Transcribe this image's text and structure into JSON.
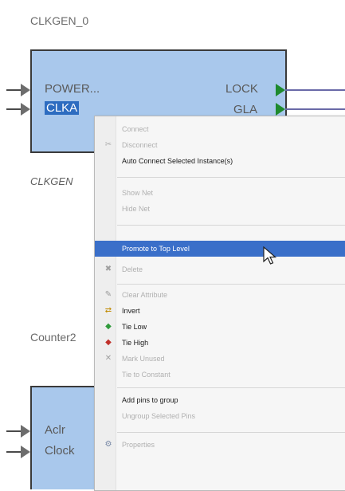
{
  "components": {
    "clkgen": {
      "title": "CLKGEN_0",
      "inputs": [
        "POWER...",
        "CLKA"
      ],
      "outputs": [
        "LOCK",
        "GLA"
      ],
      "instance_label": "CLKGEN"
    },
    "counter": {
      "title": "Counter2",
      "inputs": [
        "Aclr",
        "Clock"
      ]
    }
  },
  "context_menu": {
    "items": [
      {
        "label": "Connect",
        "icon": "",
        "enabled": false
      },
      {
        "label": "Disconnect",
        "icon": "disconnect-icon",
        "enabled": false
      },
      {
        "label": "Auto Connect Selected Instance(s)",
        "icon": "",
        "enabled": true
      },
      {
        "label": "Show Net",
        "icon": "",
        "enabled": false
      },
      {
        "label": "Hide Net",
        "icon": "",
        "enabled": false
      },
      {
        "label": "Promote to Top Level",
        "icon": "",
        "enabled": true,
        "highlighted": true
      },
      {
        "label": "Delete",
        "icon": "delete-icon",
        "enabled": false
      },
      {
        "label": "Clear Attribute",
        "icon": "clear-attribute-icon",
        "enabled": false
      },
      {
        "label": "Invert",
        "icon": "invert-icon",
        "enabled": true
      },
      {
        "label": "Tie Low",
        "icon": "tie-low-icon",
        "enabled": true
      },
      {
        "label": "Tie High",
        "icon": "tie-high-icon",
        "enabled": true
      },
      {
        "label": "Mark Unused",
        "icon": "mark-unused-icon",
        "enabled": false
      },
      {
        "label": "Tie to Constant",
        "icon": "",
        "enabled": false
      },
      {
        "label": "Add pins to group",
        "icon": "",
        "enabled": true
      },
      {
        "label": "Ungroup Selected Pins",
        "icon": "",
        "enabled": false
      },
      {
        "label": "Properties",
        "icon": "properties-icon",
        "enabled": false
      }
    ]
  },
  "colors": {
    "block_fill": "#a9c8ec",
    "output_pin": "#1e8a2e",
    "menu_highlight": "#3a6fc9",
    "selected_pin": "#2d6cc0"
  }
}
